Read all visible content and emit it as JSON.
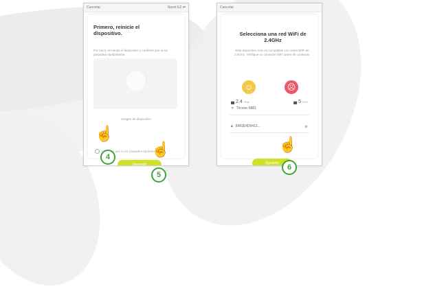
{
  "left_screen": {
    "status_left": "Cancelar",
    "status_right": "Nexxt EZ ⇄",
    "title": "Primero, reinicie el dispositivo.",
    "instructions": "Por favor, encienda el dispositivo y confirme que la luz parpadea rápidamente.",
    "device_label": "Imagen de dispositivo",
    "confirm_text": "Confirme que la luz parpadea rápidamente",
    "next_button": "Siguiente"
  },
  "right_screen": {
    "status_left": "Cancelar",
    "title": "Selecciona una red WiFi de 2.4GHz",
    "info_text": "Este dispositivo solo es compatible con redes WiFi de 2.4GHz. Verifique su conexión WiFi antes de continuar.",
    "band_24": "2.4",
    "band_24_sub": "GHz",
    "band_5": "5",
    "band_5_sub": "GHz",
    "network_name": "Tricolor-5881",
    "password": "8981E4D9412...",
    "next_button": "Siguiente"
  },
  "callouts": {
    "step_4": "4",
    "step_5": "5",
    "step_6": "6",
    "accent_color": "#3fa33a"
  }
}
